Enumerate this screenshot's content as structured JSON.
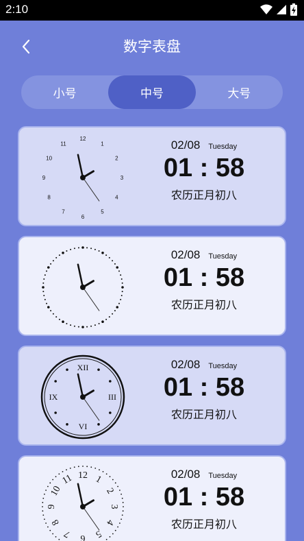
{
  "status": {
    "time": "2:10"
  },
  "header": {
    "title": "数字表盘"
  },
  "tabs": [
    {
      "label": "小号",
      "active": false
    },
    {
      "label": "中号",
      "active": true
    },
    {
      "label": "大号",
      "active": false
    }
  ],
  "cards": [
    {
      "style": "arabic",
      "date": "02/08",
      "weekday": "Tuesday",
      "time": "01 : 58",
      "lunar": "农历正月初八"
    },
    {
      "style": "dots",
      "date": "02/08",
      "weekday": "Tuesday",
      "time": "01 : 58",
      "lunar": "农历正月初八"
    },
    {
      "style": "roman",
      "date": "02/08",
      "weekday": "Tuesday",
      "time": "01 : 58",
      "lunar": "农历正月初八"
    },
    {
      "style": "rotated",
      "date": "02/08",
      "weekday": "Tuesday",
      "time": "01 : 58",
      "lunar": "农历正月初八"
    }
  ],
  "clock_faces": {
    "arabic_numerals": [
      "12",
      "1",
      "2",
      "3",
      "4",
      "5",
      "6",
      "7",
      "8",
      "9",
      "10",
      "11"
    ],
    "roman_numerals": [
      "XII",
      "III",
      "VI",
      "IX"
    ]
  },
  "colors": {
    "background": "#6f7fd9",
    "tab_active": "#4f60c6",
    "tab_track": "#8493e0"
  },
  "icons": {
    "back": "chevron-left-icon",
    "wifi": "wifi-icon",
    "signal": "signal-icon",
    "battery": "battery-charging-icon"
  }
}
